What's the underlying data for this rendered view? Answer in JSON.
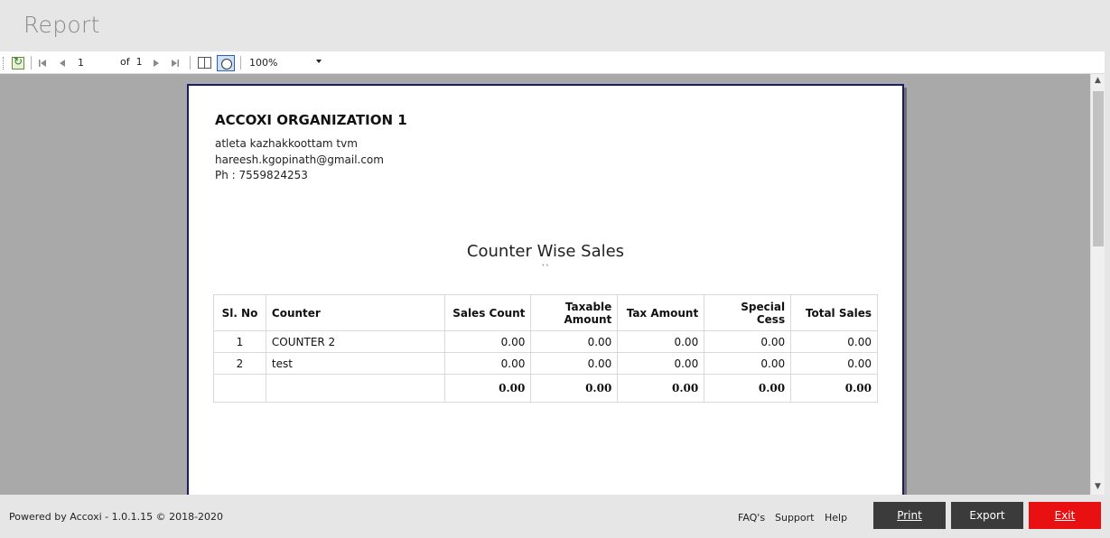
{
  "window": {
    "title": "Report"
  },
  "toolbar": {
    "page_current": "1",
    "of_label": "of",
    "page_total": "1",
    "zoom": "100%"
  },
  "report": {
    "org_name": "ACCOXI ORGANIZATION 1",
    "address": "atleta kazhakkoottam tvm",
    "email": "hareesh.kgopinath@gmail.com",
    "phone": "Ph : 7559824253",
    "title": "Counter Wise Sales",
    "subtitle": "``",
    "columns": {
      "sl": "Sl. No",
      "counter": "Counter",
      "sales_count": "Sales Count",
      "taxable_amount_1": "Taxable",
      "taxable_amount_2": "Amount",
      "tax_amount": "Tax Amount",
      "special_cess": "Special Cess",
      "total_sales": "Total Sales"
    },
    "rows": [
      {
        "sl": "1",
        "counter": "COUNTER 2",
        "sales_count": "0.00",
        "taxable": "0.00",
        "tax": "0.00",
        "cess": "0.00",
        "total": "0.00"
      },
      {
        "sl": "2",
        "counter": "test",
        "sales_count": "0.00",
        "taxable": "0.00",
        "tax": "0.00",
        "cess": "0.00",
        "total": "0.00"
      }
    ],
    "totals": {
      "sales_count": "0.00",
      "taxable": "0.00",
      "tax": "0.00",
      "cess": "0.00",
      "total": "0.00"
    }
  },
  "footer": {
    "powered": "Powered by Accoxi - 1.0.1.15 © 2018-2020",
    "faq": "FAQ's",
    "support": "Support",
    "help": "Help",
    "print": "Print",
    "export": "Export",
    "exit": "Exit"
  },
  "colors": {
    "exit_button": "#e81010",
    "dark_button": "#3b3b3b",
    "page_border": "#1a1a6e",
    "viewer_bg": "#a9a9a9"
  }
}
